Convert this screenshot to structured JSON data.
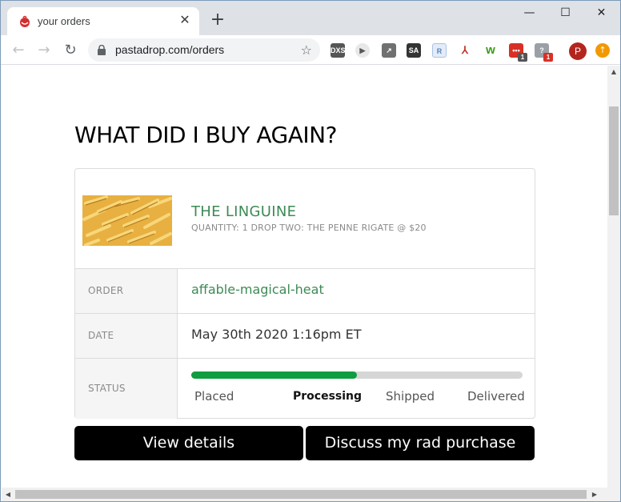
{
  "browser": {
    "tab_title": "your orders",
    "url": "pastadrop.com/orders",
    "profile_initial": "P",
    "extensions": [
      {
        "name": "dxs-icon",
        "label": "DXS",
        "color": "#555555",
        "badge": ""
      },
      {
        "name": "media-icon",
        "label": "",
        "color": "#e0e0e0",
        "badge": ""
      },
      {
        "name": "chart-icon",
        "label": "",
        "color": "#707070",
        "badge": ""
      },
      {
        "name": "sa-icon",
        "label": "SA",
        "color": "#333333",
        "badge": ""
      },
      {
        "name": "r-icon",
        "label": "R",
        "color": "#a9c3e6",
        "badge": ""
      },
      {
        "name": "pdf-icon",
        "label": "",
        "color": "#c0392b",
        "badge": ""
      },
      {
        "name": "w-icon",
        "label": "w",
        "color": "#ffffff",
        "badge": ""
      },
      {
        "name": "calendar-icon",
        "label": "•••",
        "color": "#d93025",
        "badge": "1"
      },
      {
        "name": "help-icon",
        "label": "?",
        "color": "#9aa0a6",
        "badge": "1"
      }
    ]
  },
  "page": {
    "title": "WHAT DID I BUY AGAIN?",
    "product": {
      "name": "THE LINGUINE",
      "subtitle": "QUANTITY: 1 DROP TWO: THE PENNE RIGATE @ $20"
    },
    "order": {
      "label": "ORDER",
      "value": "affable-magical-heat"
    },
    "date": {
      "label": "DATE",
      "value": "May 30th 2020 1:16pm ET"
    },
    "status": {
      "label": "STATUS",
      "progress": 0.5,
      "stages": [
        "Placed",
        "Processing",
        "Shipped",
        "Delivered"
      ],
      "current_stage": "Processing"
    },
    "buttons": {
      "details": "View details",
      "discuss": "Discuss my rad purchase"
    }
  },
  "colors": {
    "accent_green": "#3d8a55",
    "progress_green": "#0f9d40"
  }
}
